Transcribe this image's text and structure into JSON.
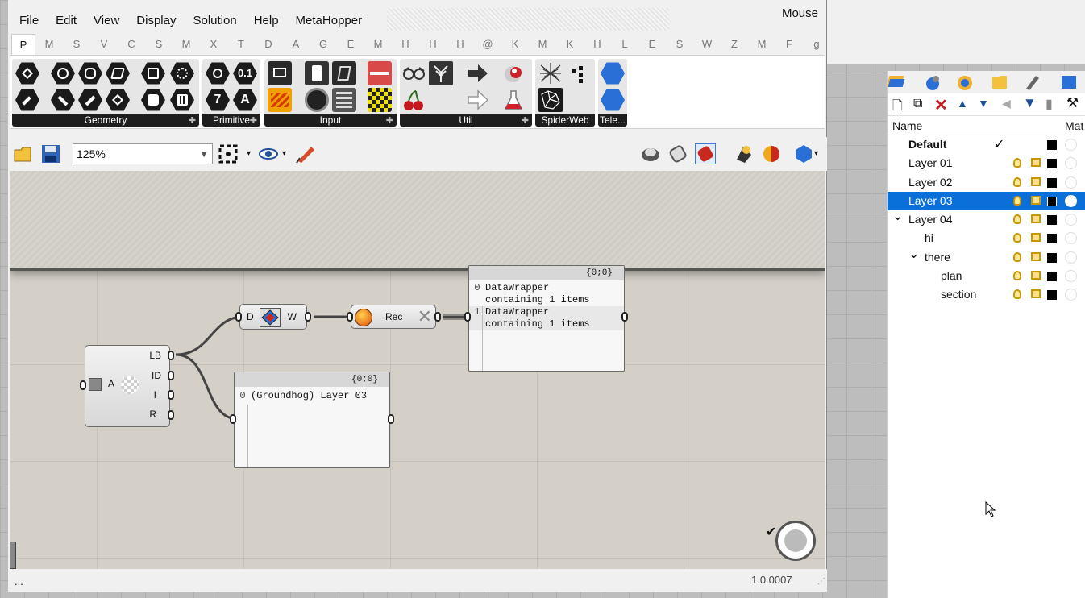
{
  "window": {
    "menus": [
      "File",
      "Edit",
      "View",
      "Display",
      "Solution",
      "Help",
      "MetaHopper"
    ],
    "right_label": "Mouse"
  },
  "tabs": [
    "P",
    "M",
    "S",
    "V",
    "C",
    "S",
    "M",
    "X",
    "T",
    "D",
    "A",
    "G",
    "E",
    "M",
    "H",
    "H",
    "H",
    "@",
    "K",
    "M",
    "K",
    "H",
    "L",
    "E",
    "S",
    "W",
    "Z",
    "M",
    "F",
    "g"
  ],
  "ribbon": {
    "panels": [
      "Geometry",
      "Primitive",
      "Input",
      "Util",
      "SpiderWeb",
      "Tele..."
    ]
  },
  "toolbar": {
    "zoom": "125%"
  },
  "canvas": {
    "layer_node": {
      "input": "A",
      "outputs": [
        "LB",
        "ID",
        "I",
        "R"
      ]
    },
    "wrapper_node": {
      "input": "D",
      "output": "W"
    },
    "record_node": {
      "label": "Rec"
    },
    "panel_top": {
      "path": "{0;0}",
      "rows": [
        {
          "index": "0",
          "text": "DataWrapper\ncontaining 1 items"
        },
        {
          "index": "1",
          "text": "DataWrapper\ncontaining 1 items"
        }
      ]
    },
    "panel_bottom": {
      "path": "{0;0}",
      "rows": [
        {
          "index": "0",
          "text": "(Groundhog) Layer 03"
        }
      ]
    }
  },
  "status": {
    "left": "...",
    "version": "1.0.0007"
  },
  "layers_panel": {
    "columns": {
      "name": "Name",
      "material": "Mat"
    },
    "rows": [
      {
        "name": "Default",
        "indent": 0,
        "bold": true,
        "current": true,
        "selected": false,
        "expanded": null
      },
      {
        "name": "Layer 01",
        "indent": 0,
        "bold": false,
        "current": false,
        "selected": false,
        "expanded": null
      },
      {
        "name": "Layer 02",
        "indent": 0,
        "bold": false,
        "current": false,
        "selected": false,
        "expanded": null
      },
      {
        "name": "Layer 03",
        "indent": 0,
        "bold": false,
        "current": false,
        "selected": true,
        "expanded": null
      },
      {
        "name": "Layer 04",
        "indent": 0,
        "bold": false,
        "current": false,
        "selected": false,
        "expanded": true
      },
      {
        "name": "hi",
        "indent": 1,
        "bold": false,
        "current": false,
        "selected": false,
        "expanded": null
      },
      {
        "name": "there",
        "indent": 1,
        "bold": false,
        "current": false,
        "selected": false,
        "expanded": true
      },
      {
        "name": "plan",
        "indent": 2,
        "bold": false,
        "current": false,
        "selected": false,
        "expanded": null
      },
      {
        "name": "section",
        "indent": 2,
        "bold": false,
        "current": false,
        "selected": false,
        "expanded": null
      }
    ]
  },
  "colors": {
    "selection": "#0a6fd8",
    "canvas": "#d4d0c8"
  }
}
